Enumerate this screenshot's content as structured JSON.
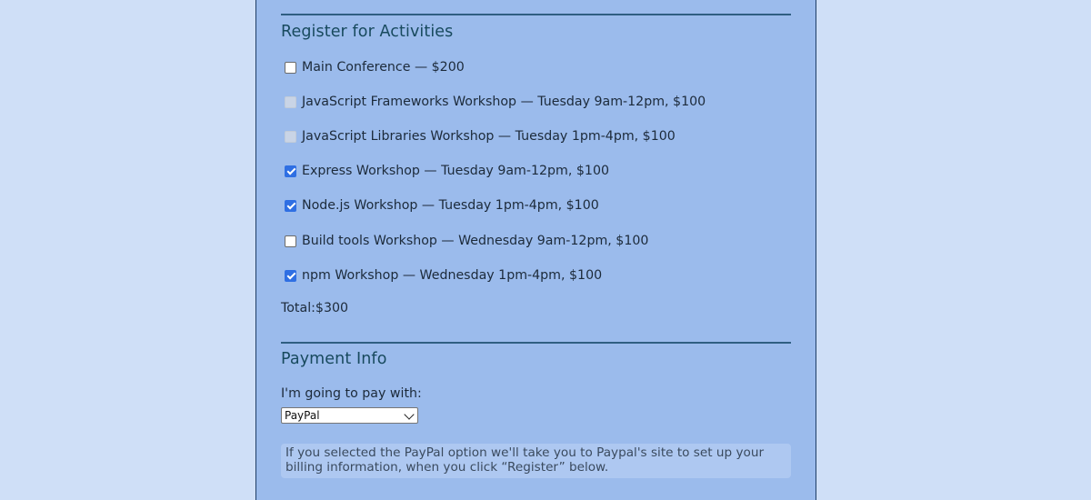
{
  "activities_section": {
    "title": "Register for Activities",
    "items": [
      {
        "label": "Main Conference — $200",
        "checked": false,
        "disabled": false
      },
      {
        "label": "JavaScript Frameworks Workshop — Tuesday 9am-12pm, $100",
        "checked": false,
        "disabled": true
      },
      {
        "label": "JavaScript Libraries Workshop — Tuesday 1pm-4pm, $100",
        "checked": false,
        "disabled": true
      },
      {
        "label": "Express Workshop — Tuesday 9am-12pm, $100",
        "checked": true,
        "disabled": false
      },
      {
        "label": "Node.js Workshop — Tuesday 1pm-4pm, $100",
        "checked": true,
        "disabled": false
      },
      {
        "label": "Build tools Workshop — Wednesday 9am-12pm, $100",
        "checked": false,
        "disabled": false
      },
      {
        "label": "npm Workshop — Wednesday 1pm-4pm, $100",
        "checked": true,
        "disabled": false
      }
    ],
    "total": "Total:$300"
  },
  "payment_section": {
    "title": "Payment Info",
    "pay_label": "I'm going to pay with:",
    "selected_method": "PayPal",
    "info_text": "If you selected the PayPal option we'll take you to Paypal's site to set up your billing information, when you click “Register” below."
  },
  "colors": {
    "page_background": "#cfdff7",
    "panel_background": "#9bbbec",
    "heading": "#184a5e",
    "checkbox_checked": "#2f6fe3"
  }
}
